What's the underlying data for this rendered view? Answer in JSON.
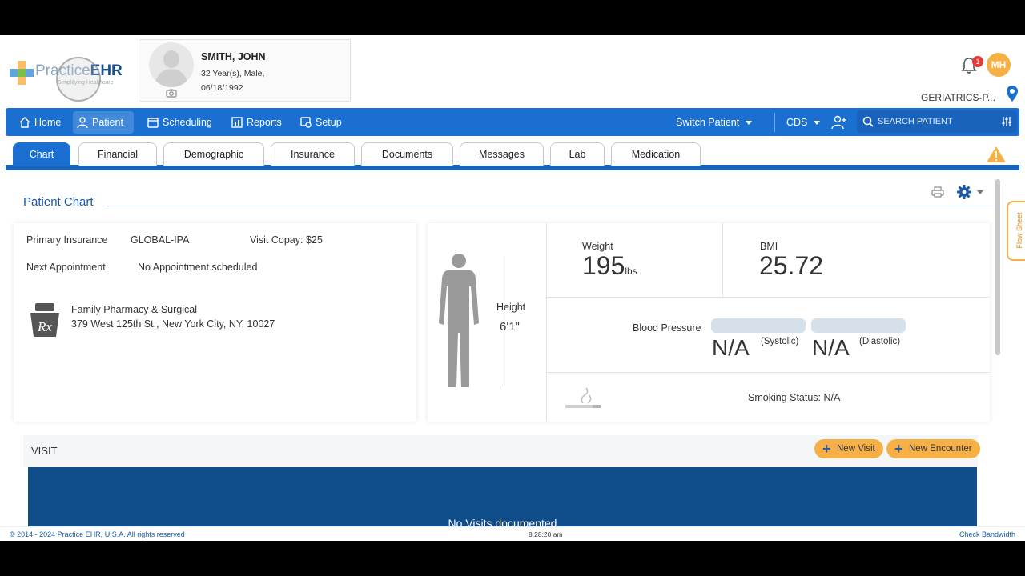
{
  "header": {
    "logo_text_light": "Practice",
    "logo_text_bold": "EHR",
    "logo_tagline": "Simplifying Healthcare",
    "user_initials": "MH",
    "notification_count": "1",
    "facility": "GERIATRICS-P..."
  },
  "patient": {
    "name": "SMITH, JOHN",
    "age_sex": "32 Year(s), Male,",
    "dob": "06/18/1992"
  },
  "nav": {
    "items": [
      {
        "label": "Home",
        "icon": "home-icon"
      },
      {
        "label": "Patient",
        "icon": "user-icon"
      },
      {
        "label": "Scheduling",
        "icon": "calendar-icon"
      },
      {
        "label": "Reports",
        "icon": "reports-icon"
      },
      {
        "label": "Setup",
        "icon": "setup-icon"
      }
    ],
    "switch_patient": "Switch Patient",
    "cds": "CDS",
    "search_placeholder": "SEARCH PATIENT"
  },
  "tabs": [
    "Chart",
    "Financial",
    "Demographic",
    "Insurance",
    "Documents",
    "Messages",
    "Lab",
    "Medication"
  ],
  "chart": {
    "title": "Patient Chart",
    "primary_insurance_label": "Primary Insurance",
    "primary_insurance_value": "GLOBAL-IPA",
    "visit_copay": "Visit Copay: $25",
    "next_appointment_label": "Next Appointment",
    "next_appointment_value": "No Appointment scheduled",
    "pharmacy_name": "Family Pharmacy & Surgical",
    "pharmacy_address": "379 West 125th St., New York City, NY, 10027",
    "flow_sheet": "Flow Sheet"
  },
  "vitals": {
    "height_label": "Height",
    "height_value": "6'1\"",
    "weight_label": "Weight",
    "weight_value": "195",
    "weight_unit": "lbs",
    "bmi_label": "BMI",
    "bmi_value": "25.72",
    "bp_label": "Blood Pressure",
    "systolic_value": "N/A",
    "systolic_label": "(Systolic)",
    "diastolic_value": "N/A",
    "diastolic_label": "(Diastolic)",
    "smoking_status": "Smoking Status: N/A"
  },
  "visit": {
    "title": "VISIT",
    "new_visit": "New Visit",
    "new_encounter": "New Encounter",
    "empty_text": "No Visits documented"
  },
  "footer": {
    "copyright": "© 2014 - 2024 Practice EHR, U.S.A. All rights reserved",
    "time": "8:28:20 am",
    "check_bandwidth": "Check Bandwidth"
  },
  "colors": {
    "primary": "#1a6fd1",
    "dark_blue": "#0f4d8a",
    "accent": "#f6b046",
    "alert": "#e53935"
  }
}
